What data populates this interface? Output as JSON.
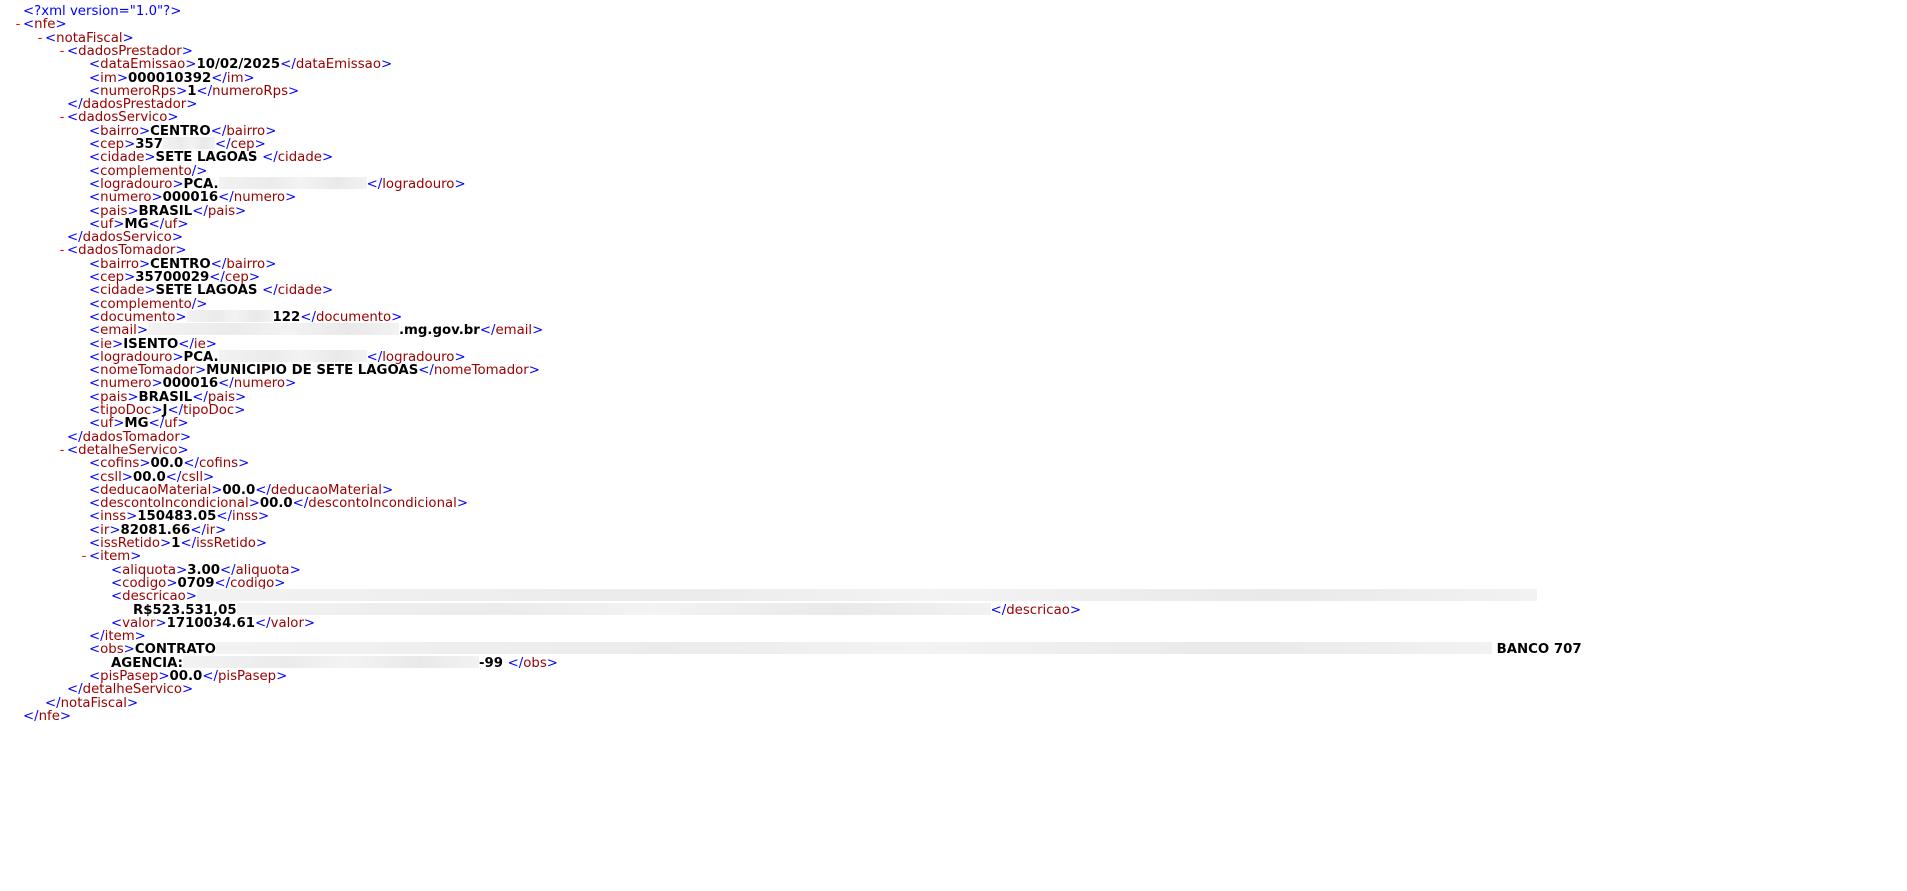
{
  "xml_declaration": "<?xml version=\"1.0\"?>",
  "collapse_symbol": "-",
  "tags": {
    "nfe": "nfe",
    "notaFiscal": "notaFiscal",
    "dadosPrestador": "dadosPrestador",
    "dadosServico": "dadosServico",
    "dadosTomador": "dadosTomador",
    "detalheServico": "detalheServico",
    "item": "item",
    "descricao": "descricao",
    "obs": "obs"
  },
  "dadosPrestador": [
    {
      "tag": "dataEmissao",
      "value": "10/02/2025"
    },
    {
      "tag": "im",
      "value": "000010392"
    },
    {
      "tag": "numeroRps",
      "value": "1"
    }
  ],
  "dadosServico": [
    {
      "tag": "bairro",
      "value": "CENTRO"
    },
    {
      "tag": "cep",
      "value": "357"
    },
    {
      "tag": "cidade",
      "value": "SETE LAGOAS "
    },
    {
      "tag": "complemento",
      "value": ""
    },
    {
      "tag": "logradouro",
      "value": "PCA."
    },
    {
      "tag": "numero",
      "value": "000016"
    },
    {
      "tag": "pais",
      "value": "BRASIL"
    },
    {
      "tag": "uf",
      "value": "MG"
    }
  ],
  "dadosTomador": [
    {
      "tag": "bairro",
      "value": "CENTRO"
    },
    {
      "tag": "cep",
      "value": "35700029"
    },
    {
      "tag": "cidade",
      "value": "SETE LAGOAS "
    },
    {
      "tag": "complemento",
      "value": ""
    },
    {
      "tag": "documento",
      "value": "122"
    },
    {
      "tag": "email",
      "value": ".mg.gov.br"
    },
    {
      "tag": "ie",
      "value": "ISENTO"
    },
    {
      "tag": "logradouro",
      "value": "PCA."
    },
    {
      "tag": "nomeTomador",
      "value": "MUNICIPIO DE SETE LAGOAS"
    },
    {
      "tag": "numero",
      "value": "000016"
    },
    {
      "tag": "pais",
      "value": "BRASIL"
    },
    {
      "tag": "tipoDoc",
      "value": "J"
    },
    {
      "tag": "uf",
      "value": "MG"
    }
  ],
  "detalheServico": [
    {
      "tag": "cofins",
      "value": "00.0"
    },
    {
      "tag": "csll",
      "value": "00.0"
    },
    {
      "tag": "deducaoMaterial",
      "value": "00.0"
    },
    {
      "tag": "descontoIncondicional",
      "value": "00.0"
    },
    {
      "tag": "inss",
      "value": "150483.05"
    },
    {
      "tag": "ir",
      "value": "82081.66"
    },
    {
      "tag": "issRetido",
      "value": "1"
    }
  ],
  "item": {
    "aliquota": {
      "tag": "aliquota",
      "value": "3.00"
    },
    "codigo": {
      "tag": "codigo",
      "value": "0709"
    },
    "descricao_value": "R$523.531,05",
    "valor": {
      "tag": "valor",
      "value": "1710034.61"
    }
  },
  "obs": {
    "line1_start": "CONTRATO",
    "line1_end": "BANCO 707",
    "line2_start": "AGENCIA:",
    "line2_end": "-99 "
  },
  "pisPasep": {
    "tag": "pisPasep",
    "value": "00.0"
  }
}
